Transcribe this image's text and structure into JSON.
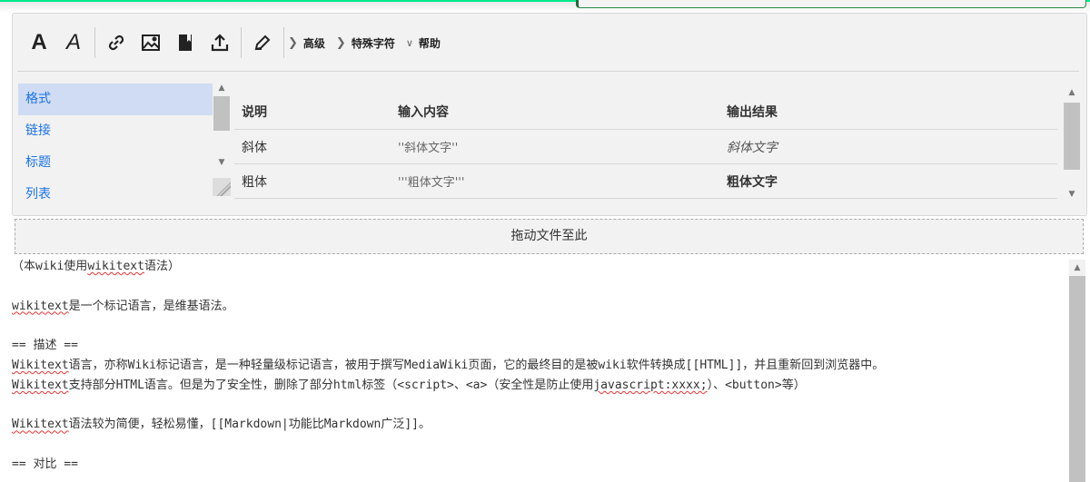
{
  "toolbar": {
    "icons": [
      "bold-icon",
      "italic-icon",
      "link-icon",
      "image-icon",
      "reference-icon",
      "upload-icon",
      "signature-icon"
    ],
    "menus": [
      {
        "label": "高级",
        "state": "collapsed"
      },
      {
        "label": "特殊字符",
        "state": "collapsed"
      },
      {
        "label": "帮助",
        "state": "expanded"
      }
    ]
  },
  "help": {
    "sections": [
      "格式",
      "链接",
      "标题",
      "列表"
    ],
    "selected": "格式",
    "columns": [
      "说明",
      "输入内容",
      "输出结果"
    ],
    "rows": [
      {
        "desc": "斜体",
        "input": "''斜体文字''",
        "output": "斜体文字"
      },
      {
        "desc": "粗体",
        "input": "'''粗体文字'''",
        "output": "粗体文字"
      }
    ]
  },
  "dropzone": {
    "label": "拖动文件至此"
  },
  "editor": {
    "l1a": "（本wiki使用",
    "l1b": "wikitext",
    "l1c": "语法）",
    "l2a": "wikitext",
    "l2b": "是一个标记语言，是维基语法。",
    "l3": "== 描述 ==",
    "l4a": "Wikitext",
    "l4b": "语言，亦称Wiki标记语言，是一种轻量级标记语言，被用于撰写MediaWiki页面，它的最终目的是被wiki软件转换成[[HTML]]，并且重新回到浏览器中。",
    "l5a": "Wikitext",
    "l5b": "支持部分HTML语言。但是为了安全性，删除了部分html标签（<script>、<a>（安全性是防止使用",
    "l5c": "javascript:xxxx;",
    "l5d": "）、<button>等）",
    "l6a": "Wikitext",
    "l6b": "语法较为简便，轻松易懂，[[Markdown|功能比Markdown广泛]]。",
    "l7": "== 对比 =="
  }
}
